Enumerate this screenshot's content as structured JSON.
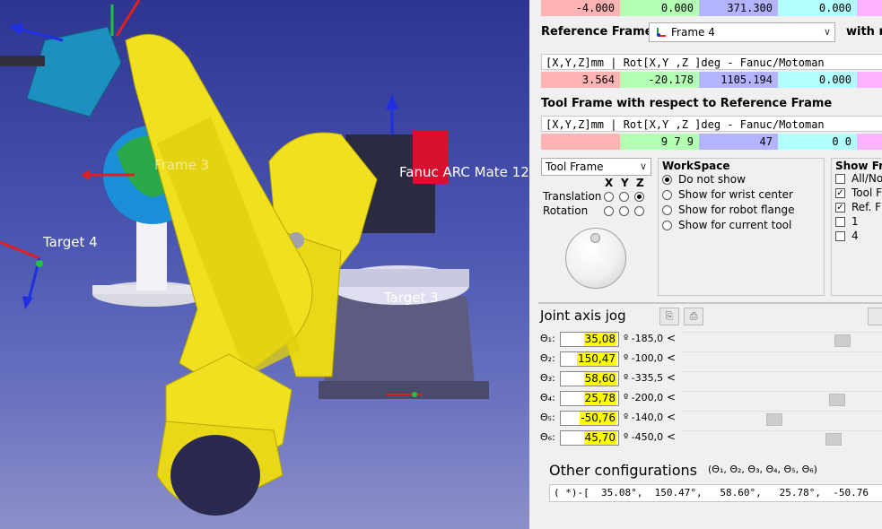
{
  "viewport": {
    "labels": {
      "frame3": "Frame 3",
      "target4": "Target 4",
      "robot": "Fanuc ARC Mate 12",
      "target3": "Target 3"
    },
    "colors": {
      "robot": "#f0e020",
      "tool": "#1e90c0",
      "base": "#5c5c80",
      "background": "#3d45a0"
    }
  },
  "top_row": {
    "values": [
      "-4.000",
      "0.000",
      "371.300",
      "0.000",
      ""
    ]
  },
  "reference_frame": {
    "label": "Reference Frame",
    "selected": "Frame 4",
    "suffix": "with re",
    "format": "[X,Y,Z]mm | Rot[X,Y ,Z  ]deg - Fanuc/Motoman",
    "values": [
      "3.564",
      "-20.178",
      "1105.194",
      "0.000",
      ""
    ]
  },
  "tool_frame": {
    "label": "Tool Frame with respect to Reference Frame",
    "format": "[X,Y,Z]mm | Rot[X,Y ,Z  ]deg - Fanuc/Motoman",
    "values": [
      "",
      "9 7 9",
      "47",
      "0  0",
      ""
    ]
  },
  "jog": {
    "frame_select": "Tool Frame",
    "axes": [
      "X",
      "Y",
      "Z"
    ],
    "translation_label": "Translation",
    "rotation_label": "Rotation"
  },
  "workspace": {
    "title": "WorkSpace",
    "options": [
      "Do not show",
      "Show for wrist center",
      "Show for robot flange",
      "Show for current tool"
    ],
    "selected": 0
  },
  "show_frames": {
    "title": "Show Fr",
    "items": [
      {
        "label": "All/No",
        "checked": false
      },
      {
        "label": "Tool F",
        "checked": true
      },
      {
        "label": "Ref. F",
        "checked": true
      },
      {
        "label": "1",
        "checked": false
      },
      {
        "label": "4",
        "checked": false
      }
    ]
  },
  "joint_jog": {
    "title": "Joint axis jog",
    "joints": [
      {
        "label": "Θ₁:",
        "value": "35,08",
        "min": "º -185,0",
        "pos": 0.83
      },
      {
        "label": "Θ₂:",
        "value": "150,47",
        "min": "º -100,0",
        "pos": 0.0
      },
      {
        "label": "Θ₃:",
        "value": "58,60",
        "min": "º -335,5",
        "pos": 0.0
      },
      {
        "label": "Θ₄:",
        "value": "25,78",
        "min": "º -200,0",
        "pos": 0.8
      },
      {
        "label": "Θ₅:",
        "value": "-50,76",
        "min": "º -140,0",
        "pos": 0.46
      },
      {
        "label": "Θ₆:",
        "value": "45,70",
        "min": "º -450,0",
        "pos": 0.78
      }
    ]
  },
  "other_configs": {
    "title": "Other configurations",
    "subtitle": "(Θ₁, Θ₂, Θ₃, Θ₄, Θ₅, Θ₆)",
    "row": "( *)-[  35.08°,  150.47°,   58.60°,   25.78°,  -50.76"
  }
}
